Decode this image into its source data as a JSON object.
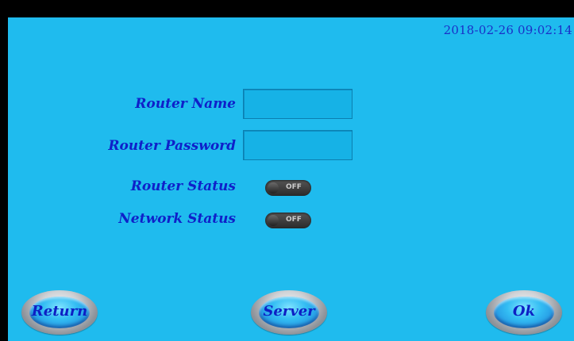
{
  "header": {
    "datetime": "2018-02-26 09:02:14"
  },
  "form": {
    "router_name_label": "Router Name",
    "router_name_value": "",
    "router_password_label": "Router Password",
    "router_password_value": "",
    "router_status_label": "Router Status",
    "router_status_state": "OFF",
    "network_status_label": "Network Status",
    "network_status_state": "OFF"
  },
  "buttons": {
    "return_label": "Return",
    "server_label": "Server",
    "ok_label": "Ok"
  },
  "colors": {
    "background": "#1fbbee",
    "label_text": "#0f20c9",
    "topbar": "#000000"
  }
}
